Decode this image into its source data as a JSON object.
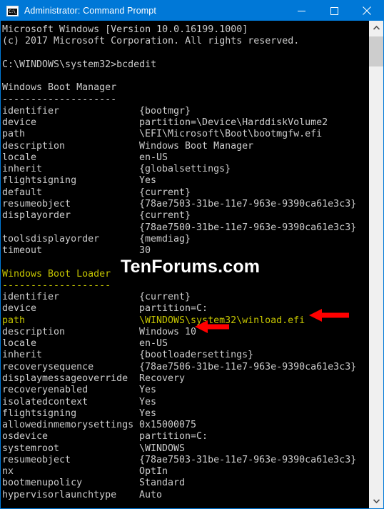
{
  "window": {
    "title": "Administrator: Command Prompt",
    "icon": "console-icon",
    "icon_glyph": "C:\\_",
    "controls": {
      "minimize": "Minimize",
      "maximize": "Maximize",
      "close": "Close"
    },
    "titlebar_color": "#0078d7",
    "background_color": "#000000",
    "text_color": "#cccccc",
    "highlight_color": "#c5c500",
    "arrow_color": "#ff0000"
  },
  "watermark": "TenForums.com",
  "console": {
    "lines": [
      {
        "type": "text",
        "text": "Microsoft Windows [Version 10.0.16199.1000]",
        "color": "white"
      },
      {
        "type": "text",
        "text": "(c) 2017 Microsoft Corporation. All rights reserved.",
        "color": "white"
      },
      {
        "type": "blank",
        "text": ""
      },
      {
        "type": "text",
        "text": "C:\\WINDOWS\\system32>bcdedit",
        "color": "white"
      },
      {
        "type": "blank",
        "text": ""
      },
      {
        "type": "text",
        "text": "Windows Boot Manager",
        "color": "white"
      },
      {
        "type": "text",
        "text": "--------------------",
        "color": "white"
      },
      {
        "type": "kv",
        "key": "identifier",
        "value": "{bootmgr}",
        "color": "white"
      },
      {
        "type": "kv",
        "key": "device",
        "value": "partition=\\Device\\HarddiskVolume2",
        "color": "white"
      },
      {
        "type": "kv",
        "key": "path",
        "value": "\\EFI\\Microsoft\\Boot\\bootmgfw.efi",
        "color": "white"
      },
      {
        "type": "kv",
        "key": "description",
        "value": "Windows Boot Manager",
        "color": "white"
      },
      {
        "type": "kv",
        "key": "locale",
        "value": "en-US",
        "color": "white"
      },
      {
        "type": "kv",
        "key": "inherit",
        "value": "{globalsettings}",
        "color": "white"
      },
      {
        "type": "kv",
        "key": "flightsigning",
        "value": "Yes",
        "color": "white"
      },
      {
        "type": "kv",
        "key": "default",
        "value": "{current}",
        "color": "white"
      },
      {
        "type": "kv",
        "key": "resumeobject",
        "value": "{78ae7503-31be-11e7-963e-9390ca61e3c3}",
        "color": "white"
      },
      {
        "type": "kv",
        "key": "displayorder",
        "value": "{current}",
        "color": "white"
      },
      {
        "type": "kv",
        "key": "",
        "value": "{78ae7500-31be-11e7-963e-9390ca61e3c3}",
        "color": "white"
      },
      {
        "type": "kv",
        "key": "toolsdisplayorder",
        "value": "{memdiag}",
        "color": "white"
      },
      {
        "type": "kv",
        "key": "timeout",
        "value": "30",
        "color": "white"
      },
      {
        "type": "blank",
        "text": ""
      },
      {
        "type": "text",
        "text": "Windows Boot Loader",
        "color": "yellow"
      },
      {
        "type": "text",
        "text": "-------------------",
        "color": "yellow"
      },
      {
        "type": "kv",
        "key": "identifier",
        "value": "{current}",
        "color": "white"
      },
      {
        "type": "kv",
        "key": "device",
        "value": "partition=C:",
        "color": "white"
      },
      {
        "type": "kv",
        "key": "path",
        "value": "\\WINDOWS\\system32\\winload.efi",
        "color": "yellow"
      },
      {
        "type": "kv",
        "key": "description",
        "value": "Windows 10",
        "color": "white"
      },
      {
        "type": "kv",
        "key": "locale",
        "value": "en-US",
        "color": "white"
      },
      {
        "type": "kv",
        "key": "inherit",
        "value": "{bootloadersettings}",
        "color": "white"
      },
      {
        "type": "kv",
        "key": "recoverysequence",
        "value": "{78ae7506-31be-11e7-963e-9390ca61e3c3}",
        "color": "white"
      },
      {
        "type": "kv",
        "key": "displaymessageoverride",
        "value": "Recovery",
        "color": "white"
      },
      {
        "type": "kv",
        "key": "recoveryenabled",
        "value": "Yes",
        "color": "white"
      },
      {
        "type": "kv",
        "key": "isolatedcontext",
        "value": "Yes",
        "color": "white"
      },
      {
        "type": "kv",
        "key": "flightsigning",
        "value": "Yes",
        "color": "white"
      },
      {
        "type": "kv",
        "key": "allowedinmemorysettings",
        "value": "0x15000075",
        "color": "white"
      },
      {
        "type": "kv",
        "key": "osdevice",
        "value": "partition=C:",
        "color": "white"
      },
      {
        "type": "kv",
        "key": "systemroot",
        "value": "\\WINDOWS",
        "color": "white"
      },
      {
        "type": "kv",
        "key": "resumeobject",
        "value": "{78ae7503-31be-11e7-963e-9390ca61e3c3}",
        "color": "white"
      },
      {
        "type": "kv",
        "key": "nx",
        "value": "OptIn",
        "color": "white"
      },
      {
        "type": "kv",
        "key": "bootmenupolicy",
        "value": "Standard",
        "color": "white"
      },
      {
        "type": "kv",
        "key": "hypervisorlaunchtype",
        "value": "Auto",
        "color": "white"
      }
    ]
  },
  "annotations": [
    {
      "name": "arrow-path",
      "points_to": "path"
    },
    {
      "name": "arrow-description",
      "points_to": "description"
    }
  ],
  "scrollbar": {
    "up": "Scroll up",
    "down": "Scroll down",
    "thumb": "Scroll thumb"
  }
}
